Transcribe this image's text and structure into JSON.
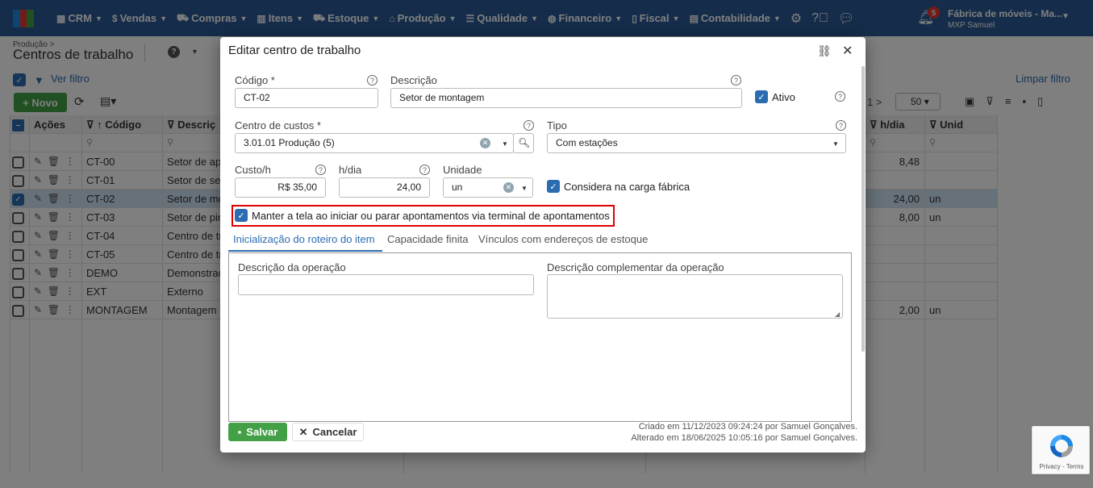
{
  "nav": {
    "items": [
      {
        "label": "CRM",
        "icon": "crm-icon",
        "glyph": "▦"
      },
      {
        "label": "Vendas",
        "icon": "dollar-icon",
        "glyph": "$"
      },
      {
        "label": "Compras",
        "icon": "cart-icon",
        "glyph": "⛟"
      },
      {
        "label": "Itens",
        "icon": "barcode-icon",
        "glyph": "▥"
      },
      {
        "label": "Estoque",
        "icon": "truck-icon",
        "glyph": "⛟"
      },
      {
        "label": "Produção",
        "icon": "factory-icon",
        "glyph": "⌂"
      },
      {
        "label": "Qualidade",
        "icon": "checklist-icon",
        "glyph": "☰"
      },
      {
        "label": "Financeiro",
        "icon": "money-bag-icon",
        "glyph": "◍"
      },
      {
        "label": "Fiscal",
        "icon": "document-icon",
        "glyph": "▯"
      },
      {
        "label": "Contabilidade",
        "icon": "calculator-icon",
        "glyph": "▤"
      }
    ],
    "notifications": "5",
    "company": "Fábrica de móveis - Ma...",
    "user": "MXP Samuel"
  },
  "page": {
    "breadcrumb": "Produção >",
    "title": "Centros de trabalho",
    "help": "?",
    "filter_label": "Ver filtro",
    "clear_filter": "Limpar filtro",
    "new_button": "+ Novo",
    "pager_text": "1 >",
    "page_size": "50"
  },
  "grid": {
    "headers": [
      "Ações",
      "↑ Código",
      "Descriç",
      "h/dia",
      "Unid"
    ],
    "rows": [
      {
        "code": "CT-00",
        "desc": "Setor de ap",
        "hdia": "8,48",
        "unit": "",
        "selected": false
      },
      {
        "code": "CT-01",
        "desc": "Setor de sep",
        "hdia": "",
        "unit": "",
        "selected": false
      },
      {
        "code": "CT-02",
        "desc": "Setor de mo",
        "hdia": "24,00",
        "unit": "un",
        "selected": true
      },
      {
        "code": "CT-03",
        "desc": "Setor de pir",
        "hdia": "8,00",
        "unit": "un",
        "selected": false
      },
      {
        "code": "CT-04",
        "desc": "Centro de tr",
        "hdia": "",
        "unit": "",
        "selected": false
      },
      {
        "code": "CT-05",
        "desc": "Centro de tr",
        "hdia": "",
        "unit": "",
        "selected": false
      },
      {
        "code": "DEMO",
        "desc": "Demonstraç",
        "hdia": "",
        "unit": "",
        "selected": false
      },
      {
        "code": "EXT",
        "desc": "Externo",
        "hdia": "",
        "unit": "",
        "selected": false
      },
      {
        "code": "MONTAGEM",
        "desc": "Montagem",
        "hdia": "2,00",
        "unit": "un",
        "selected": false
      }
    ]
  },
  "modal": {
    "title": "Editar centro de trabalho",
    "codigo_label": "Código *",
    "codigo_value": "CT-02",
    "descricao_label": "Descrição",
    "descricao_value": "Setor de montagem",
    "ativo_label": "Ativo",
    "centro_custos_label": "Centro de custos *",
    "centro_custos_value": "3.01.01 Produção (5)",
    "tipo_label": "Tipo",
    "tipo_value": "Com estações",
    "custo_label": "Custo/h",
    "custo_value": "R$ 35,00",
    "hdia_label": "h/dia",
    "hdia_value": "24,00",
    "unidade_label": "Unidade",
    "unidade_value": "un",
    "considera_label": "Considera na carga fábrica",
    "manter_label": "Manter a tela ao iniciar ou parar apontamentos via terminal de apontamentos",
    "tabs": [
      "Inicialização do roteiro do item",
      "Capacidade finita",
      "Vínculos com endereços de estoque"
    ],
    "desc_operacao_label": "Descrição da operação",
    "desc_operacao_value": "",
    "desc_complementar_label": "Descrição complementar da operação",
    "desc_complementar_value": "",
    "save_button": "Salvar",
    "cancel_button": "Cancelar",
    "created": "Criado em 11/12/2023 09:24:24 por Samuel Gonçalves.",
    "altered": "Alterado em 18/06/2025 10:05:16 por Samuel Gonçalves."
  },
  "recaptcha": {
    "terms": "Privacy - Terms"
  },
  "colors": {
    "nav": "#2b5b94",
    "accent": "#2b6cb0",
    "success": "#43a047",
    "highlight": "#e00000"
  }
}
